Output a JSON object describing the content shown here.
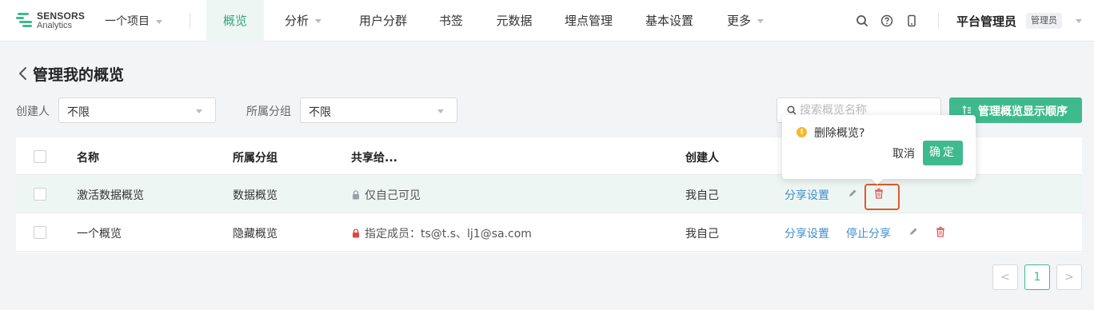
{
  "brand": {
    "line1": "SENSORS",
    "line2": "Analytics",
    "accent": "#3fba8e"
  },
  "project": {
    "label": "一个项目"
  },
  "nav": [
    {
      "label": "概览",
      "active": true
    },
    {
      "label": "分析",
      "caret": true
    },
    {
      "label": "用户分群"
    },
    {
      "label": "书签"
    },
    {
      "label": "元数据"
    },
    {
      "label": "埋点管理"
    },
    {
      "label": "基本设置"
    },
    {
      "label": "更多",
      "caret": true
    }
  ],
  "top_icons": [
    "search-icon",
    "help-icon",
    "mobile-icon"
  ],
  "user": {
    "name": "平台管理员",
    "role": "管理员"
  },
  "page": {
    "title": "管理我的概览"
  },
  "filters": {
    "creator_label": "创建人",
    "creator_value": "不限",
    "group_label": "所属分组",
    "group_value": "不限"
  },
  "search": {
    "placeholder": "搜索概览名称"
  },
  "order_button": {
    "label": "管理概览显示顺序"
  },
  "table": {
    "headers": {
      "name": "名称",
      "group": "所属分组",
      "share": "共享给...",
      "creator": "创建人"
    },
    "rows": [
      {
        "name": "激活数据概览",
        "group": "数据概览",
        "share": "仅自己可见",
        "lock": "grey",
        "creator": "我自己",
        "share_settings": "分享设置",
        "stop_share": ""
      },
      {
        "name": "一个概览",
        "group": "隐藏概览",
        "share": "指定成员：ts@t.s、lj1@sa.com",
        "lock": "red",
        "creator": "我自己",
        "share_settings": "分享设置",
        "stop_share": "停止分享"
      }
    ]
  },
  "popconfirm": {
    "message": "删除概览?",
    "cancel": "取消",
    "ok": "确定"
  },
  "pagination": {
    "prev": "<",
    "current": "1",
    "next": ">"
  }
}
